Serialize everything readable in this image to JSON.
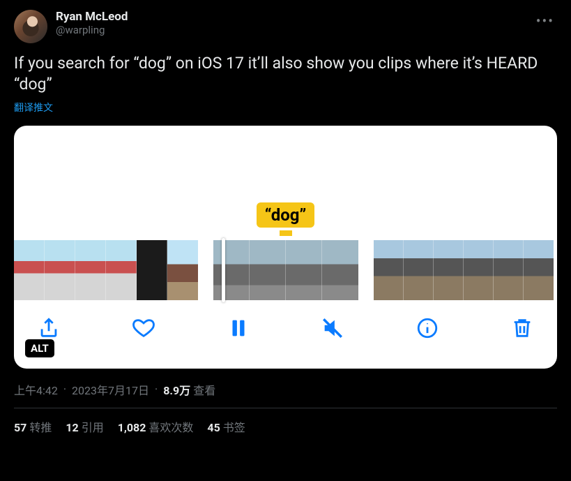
{
  "author": {
    "display_name": "Ryan McLeod",
    "handle": "@warpling"
  },
  "body_text": "If you search for “dog” on iOS 17 it’ll also show you clips where it’s HEARD “dog”",
  "translate_label": "翻译推文",
  "media": {
    "search_token": "“dog”",
    "alt_badge": "ALT"
  },
  "meta": {
    "time": "上午4:42",
    "date": "2023年7月17日",
    "views_count": "8.9万",
    "views_label": "查看"
  },
  "stats": {
    "retweets": {
      "count": "57",
      "label": "转推"
    },
    "quotes": {
      "count": "12",
      "label": "引用"
    },
    "likes": {
      "count": "1,082",
      "label": "喜欢次数"
    },
    "bookmarks": {
      "count": "45",
      "label": "书签"
    }
  }
}
